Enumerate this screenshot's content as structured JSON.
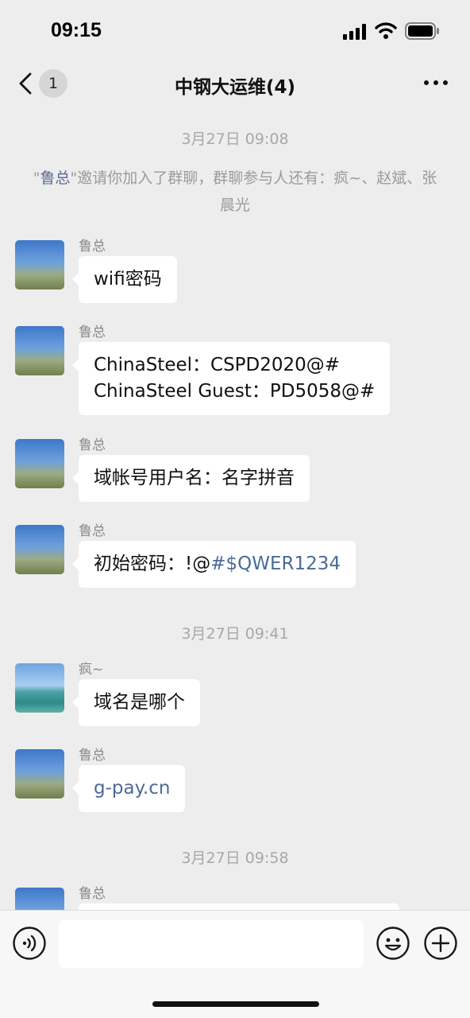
{
  "status_bar": {
    "time": "09:15"
  },
  "nav": {
    "unread_badge": "1",
    "title": "中钢大运维(4)"
  },
  "chat": {
    "timestamps": [
      "3月27日 09:08",
      "3月27日 09:41",
      "3月27日 09:58"
    ],
    "system_notice": {
      "quote_open": "\"",
      "inviter": "鲁总",
      "rest": "\"邀请你加入了群聊，群聊参与人还有：疯~、赵斌、张晨光"
    },
    "messages": [
      {
        "sender": "鲁总",
        "avatar": "plant-photo",
        "lines": [
          "wifi密码"
        ]
      },
      {
        "sender": "鲁总",
        "avatar": "plant-photo",
        "lines": [
          "ChinaSteel：CSPD2020@#",
          "ChinaSteel Guest：PD5058@#"
        ]
      },
      {
        "sender": "鲁总",
        "avatar": "plant-photo",
        "lines": [
          "域帐号用户名：名字拼音"
        ]
      },
      {
        "sender": "鲁总",
        "avatar": "plant-photo",
        "text_prefix": "初始密码：!@",
        "link_part": "#$QWER1234"
      },
      {
        "sender": "疯~",
        "avatar": "sea-photo",
        "lines": [
          "域名是哪个"
        ]
      },
      {
        "sender": "鲁总",
        "avatar": "plant-photo",
        "link": "g-pay.cn"
      },
      {
        "sender": "鲁总",
        "avatar": "plant-photo",
        "lines": [
          ""
        ]
      }
    ]
  },
  "input_bar": {
    "voice_icon": "voice-icon",
    "emoji_icon": "emoji-icon",
    "plus_icon": "plus-icon"
  },
  "colors": {
    "background": "#ededed",
    "bubble": "#ffffff",
    "link": "#4b6a96",
    "name_highlight": "#5b6b92"
  }
}
